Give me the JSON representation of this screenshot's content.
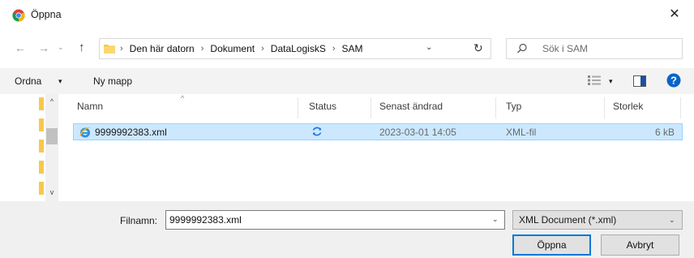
{
  "titlebar": {
    "title": "Öppna",
    "app_icon": "chrome-icon",
    "close_label": "✕"
  },
  "nav": {
    "back_icon": "←",
    "forward_icon": "→",
    "history_icon": "⌄",
    "up_icon": "↑",
    "breadcrumbs": [
      "Den här datorn",
      "Dokument",
      "DataLogiskS",
      "SAM"
    ],
    "separator": "›",
    "dropdown_icon": "⌄",
    "refresh_icon": "↻",
    "search_placeholder": "Sök i SAM"
  },
  "commandbar": {
    "organize_label": "Ordna",
    "organize_dd": "▾",
    "new_folder_label": "Ny mapp",
    "view_dd": "▾"
  },
  "navpane": {
    "up_arrow": "^",
    "down_arrow": "v"
  },
  "filelist": {
    "sort_caret": "^",
    "columns": [
      {
        "key": "name",
        "label": "Namn"
      },
      {
        "key": "status",
        "label": "Status"
      },
      {
        "key": "modified",
        "label": "Senast ändrad"
      },
      {
        "key": "type",
        "label": "Typ"
      },
      {
        "key": "size",
        "label": "Storlek"
      }
    ],
    "rows": [
      {
        "name": "9999992383.xml",
        "status_icon": "sync-icon",
        "modified": "2023-03-01 14:05",
        "type": "XML-fil",
        "size": "6 kB",
        "selected": true
      }
    ]
  },
  "bottom": {
    "filename_label": "Filnamn:",
    "filename_value": "9999992383.xml",
    "filename_dd": "⌄",
    "filetype_value": "XML Document (*.xml)",
    "filetype_dd": "⌄",
    "open_label": "Öppna",
    "cancel_label": "Avbryt"
  },
  "colors": {
    "accent": "#0078d7",
    "selection": "#cce8ff",
    "selection_border": "#99d1ff",
    "folder": "#f6c94c",
    "help": "#0a63c9"
  }
}
